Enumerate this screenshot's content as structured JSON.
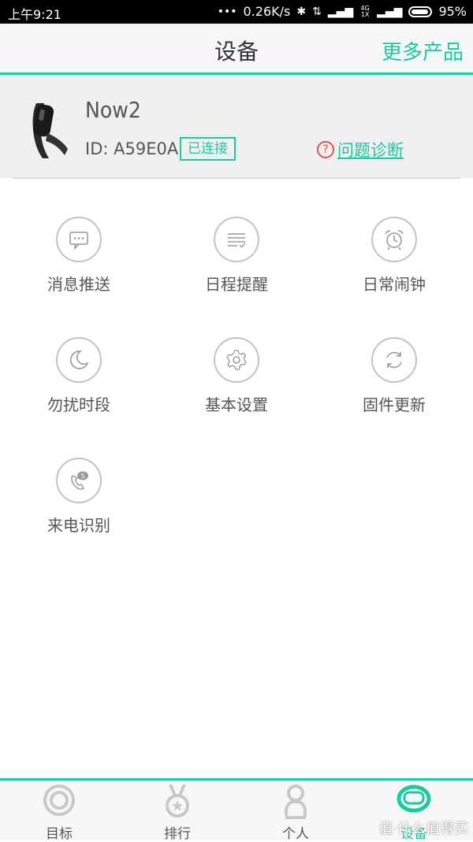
{
  "status_bar": {
    "time": "上午9:21",
    "net_speed": "0.26K/s",
    "battery": "95%",
    "network_small": "4G 1X"
  },
  "header": {
    "title": "设备",
    "more_products": "更多产品"
  },
  "device": {
    "name": "Now2",
    "id_label": "ID: A59E0A",
    "status": "已连接",
    "diagnose_icon": "?",
    "diagnose": "问题诊断"
  },
  "functions": [
    {
      "label": "消息推送",
      "icon": "message-icon"
    },
    {
      "label": "日程提醒",
      "icon": "schedule-icon"
    },
    {
      "label": "日常闹钟",
      "icon": "alarm-icon"
    },
    {
      "label": "勿扰时段",
      "icon": "moon-icon"
    },
    {
      "label": "基本设置",
      "icon": "gear-icon"
    },
    {
      "label": "固件更新",
      "icon": "refresh-icon"
    },
    {
      "label": "来电识别",
      "icon": "phone-icon"
    }
  ],
  "tabs": [
    {
      "label": "目标",
      "icon": "target-icon"
    },
    {
      "label": "排行",
      "icon": "medal-icon"
    },
    {
      "label": "个人",
      "icon": "person-icon"
    },
    {
      "label": "设备",
      "icon": "band-icon",
      "active": true
    }
  ],
  "watermark": "值·什么值得买",
  "colors": {
    "accent": "#1cc9a0",
    "warning": "#e2504b"
  }
}
